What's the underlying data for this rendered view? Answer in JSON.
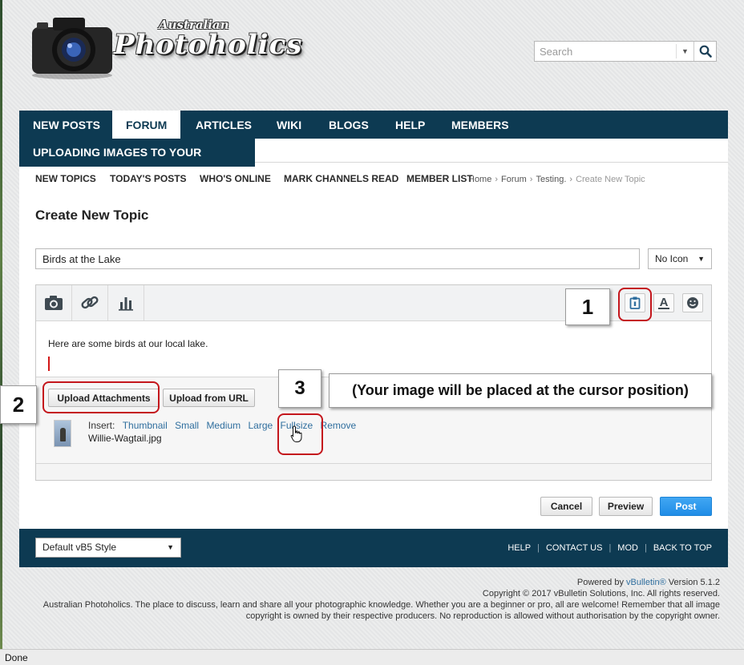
{
  "site": {
    "logo_small": "Australian",
    "logo_big": "Photoholics"
  },
  "search": {
    "placeholder": "Search"
  },
  "nav": {
    "tabs": [
      "NEW POSTS",
      "FORUM",
      "ARTICLES",
      "WIKI",
      "BLOGS",
      "HELP",
      "MEMBERS"
    ],
    "active": "FORUM",
    "sub_tab": "UPLOADING IMAGES TO YOUR POSTS"
  },
  "quicklinks": [
    "NEW TOPICS",
    "TODAY'S POSTS",
    "WHO'S ONLINE",
    "MARK CHANNELS READ",
    "MEMBER LIST"
  ],
  "breadcrumb": [
    "Home",
    "Forum",
    "Testing.",
    "Create New Topic"
  ],
  "page_title": "Create New Topic",
  "form": {
    "title_value": "Birds at the Lake",
    "icon_select": "No Icon",
    "body_text": "Here are some birds at our local lake.",
    "upload_attachments": "Upload Attachments",
    "upload_from_url": "Upload from URL",
    "insert_label": "Insert:",
    "insert_options": [
      "Thumbnail",
      "Small",
      "Medium",
      "Large",
      "Fullsize",
      "Remove"
    ],
    "filename": "Willie-Wagtail.jpg"
  },
  "actions": {
    "cancel": "Cancel",
    "preview": "Preview",
    "post": "Post"
  },
  "footer": {
    "style": "Default vB5 Style",
    "links": [
      "HELP",
      "CONTACT US",
      "MOD",
      "BACK TO TOP"
    ]
  },
  "legal": {
    "powered_prefix": "Powered by",
    "vbulletin": "vBulletin®",
    "version": "Version 5.1.2",
    "copyright": "Copyright © 2017 vBulletin Solutions, Inc. All rights reserved.",
    "about": "Australian Photoholics. The place to discuss, learn and share all your photographic knowledge. Whether you are a beginner or pro, all are welcome! Remember that all image",
    "about2": "copyright is owned by their respective producers. No reproduction is allowed without authorisation by the copyright owner."
  },
  "status": "Done",
  "annotations": {
    "one": "1",
    "two": "2",
    "three": "3",
    "note": "(Your image will be placed at the cursor position)"
  },
  "colors": {
    "nav": "#0d3a52",
    "link": "#2f6e9e",
    "post_button": "#2a95ea",
    "annotation": "#c4161c"
  },
  "icons": [
    "camera-icon",
    "link-icon",
    "chart-icon",
    "clipboard-icon",
    "font-color-icon",
    "smiley-icon",
    "search-icon",
    "hand-cursor-icon"
  ]
}
